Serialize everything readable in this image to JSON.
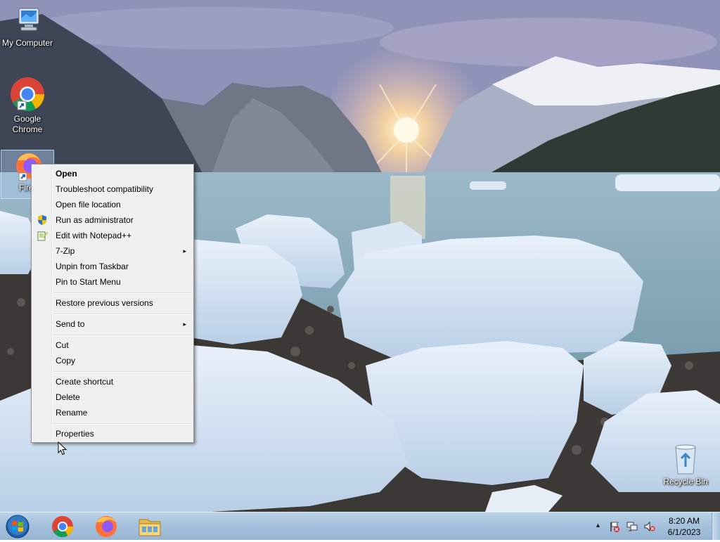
{
  "desktop": {
    "icons": [
      {
        "label": "My Computer"
      },
      {
        "label": "Google Chrome"
      },
      {
        "label": "Firef"
      },
      {
        "label": "Recycle Bin"
      }
    ]
  },
  "context_menu": {
    "items": [
      {
        "label": "Open",
        "bold": true
      },
      {
        "label": "Troubleshoot compatibility"
      },
      {
        "label": "Open file location"
      },
      {
        "label": "Run as administrator",
        "icon": "uac-shield-icon"
      },
      {
        "label": "Edit with Notepad++",
        "icon": "notepad-plus-plus-icon"
      },
      {
        "label": "7-Zip",
        "submenu": true
      },
      {
        "label": "Unpin from Taskbar"
      },
      {
        "label": "Pin to Start Menu"
      },
      {
        "label": "Restore previous versions"
      },
      {
        "label": "Send to",
        "submenu": true
      },
      {
        "label": "Cut"
      },
      {
        "label": "Copy"
      },
      {
        "label": "Create shortcut"
      },
      {
        "label": "Delete"
      },
      {
        "label": "Rename"
      },
      {
        "label": "Properties"
      }
    ],
    "submenu_arrow": "▸"
  },
  "taskbar": {
    "pinned": [
      "start-orb",
      "chrome-icon",
      "firefox-icon",
      "file-explorer-icon"
    ],
    "tray_chevron": "▲",
    "clock": {
      "time": "8:20 AM",
      "date": "6/1/2023"
    }
  },
  "colors": {
    "menu_bg": "#f0f0f0",
    "taskbar": "#a6c1dc",
    "accent": "#3a7bd5"
  }
}
